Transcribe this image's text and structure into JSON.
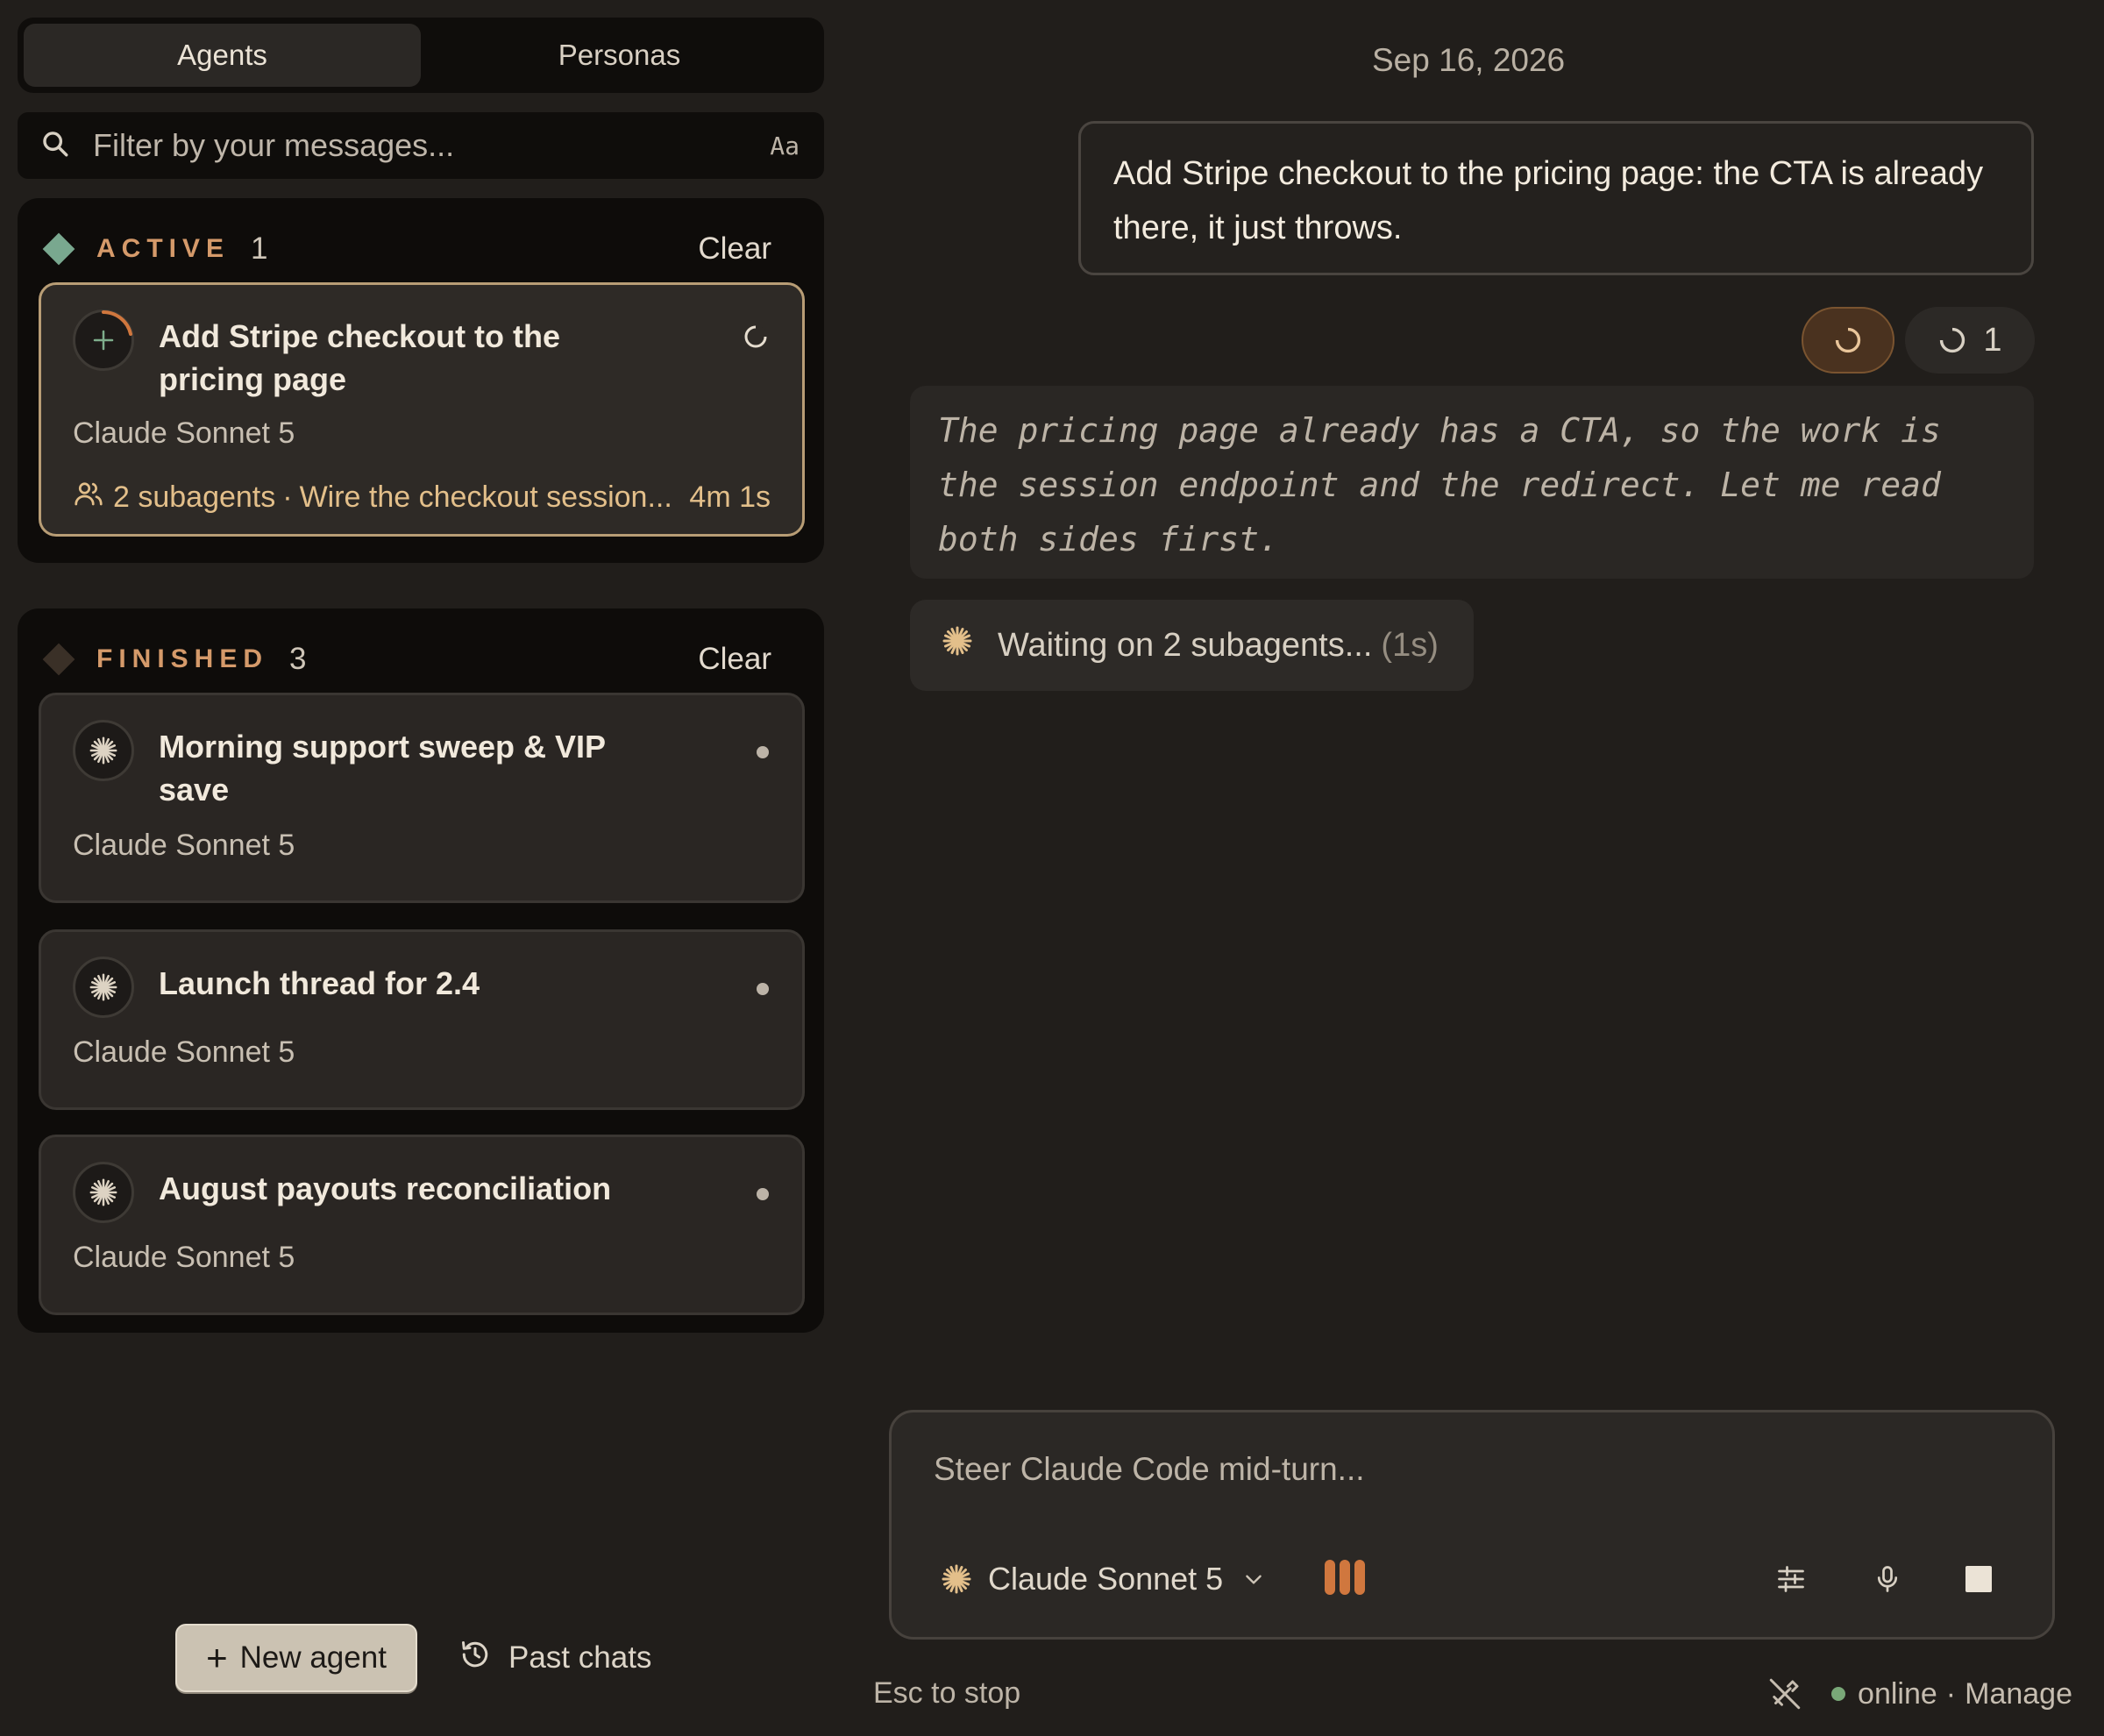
{
  "sidebar": {
    "tabs": [
      {
        "label": "Agents",
        "active": true
      },
      {
        "label": "Personas",
        "active": false
      }
    ],
    "search": {
      "placeholder": "Filter by your messages...",
      "case_toggle": "Aa"
    },
    "active_section": {
      "label": "ACTIVE",
      "count": "1",
      "clear_label": "Clear",
      "marker_color": "#79a88f",
      "items": [
        {
          "title": "Add Stripe checkout to the pricing page",
          "model": "Claude Sonnet 5",
          "subagents": "2 subagents",
          "subagent_task": "Wire the checkout session...",
          "elapsed": "4m 1s",
          "status": "running"
        }
      ]
    },
    "finished_section": {
      "label": "FINISHED",
      "count": "3",
      "clear_label": "Clear",
      "marker_color": "#3a3027",
      "items": [
        {
          "title": "Morning support sweep & VIP save",
          "model": "Claude Sonnet 5"
        },
        {
          "title": "Launch thread for 2.4",
          "model": "Claude Sonnet 5"
        },
        {
          "title": "August payouts reconciliation",
          "model": "Claude Sonnet 5"
        }
      ]
    },
    "new_agent_label": "New agent",
    "past_chats_label": "Past chats"
  },
  "conversation": {
    "date": "Sep 16, 2026",
    "user_message": "Add Stripe checkout to the pricing page: the CTA is already there, it just throws.",
    "subagent_count": "1",
    "thinking": "The pricing page already has a CTA, so the work is the session endpoint and the redirect. Let me read both sides first.",
    "waiting_text": "Waiting on 2 subagents...",
    "waiting_elapsed": "(1s)"
  },
  "composer": {
    "placeholder": "Steer Claude Code mid-turn...",
    "model": "Claude Sonnet 5",
    "esc_hint": "Esc to stop",
    "status": "online",
    "manage_label": "Manage"
  },
  "colors": {
    "accent": "#d0773e",
    "active_border": "#b89d75",
    "subagent_text": "#e3bf8a",
    "online": "#79a878"
  }
}
